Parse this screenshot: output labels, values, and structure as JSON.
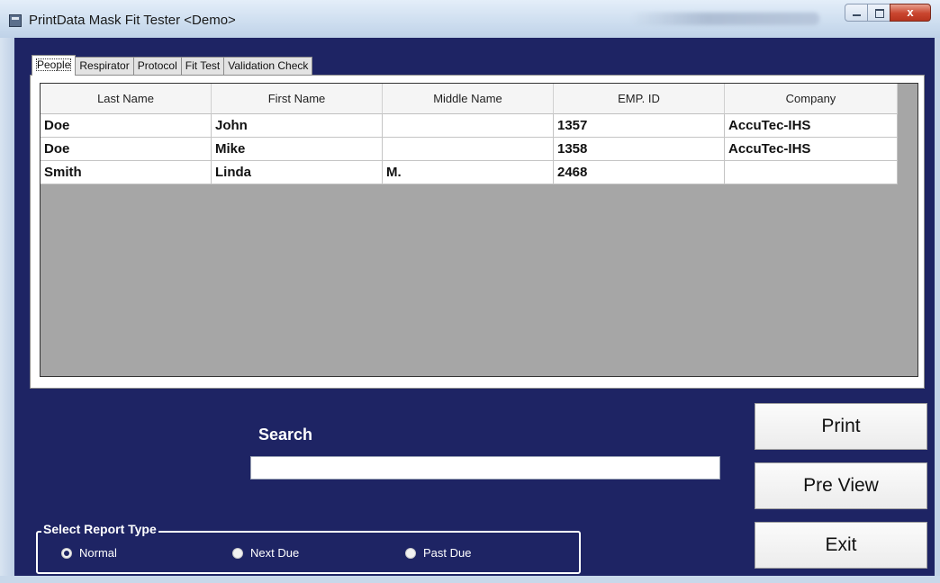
{
  "window": {
    "title": "PrintData Mask Fit Tester <Demo>",
    "close_glyph": "x"
  },
  "tabs": [
    {
      "label": "People",
      "active": true
    },
    {
      "label": "Respirator",
      "active": false
    },
    {
      "label": "Protocol",
      "active": false
    },
    {
      "label": "Fit Test",
      "active": false
    },
    {
      "label": "Validation Check",
      "active": false
    }
  ],
  "table": {
    "columns": [
      "Last Name",
      "First Name",
      "Middle Name",
      "EMP. ID",
      "Company"
    ],
    "rows": [
      [
        "Doe",
        "John",
        "",
        "1357",
        "AccuTec-IHS"
      ],
      [
        "Doe",
        "Mike",
        "",
        "1358",
        "AccuTec-IHS"
      ],
      [
        "Smith",
        "Linda",
        "M.",
        "2468",
        ""
      ]
    ]
  },
  "search": {
    "label": "Search",
    "value": ""
  },
  "buttons": {
    "print": "Print",
    "preview": "Pre View",
    "exit": "Exit"
  },
  "report_type": {
    "title": "Select Report Type",
    "options": [
      {
        "label": "Normal",
        "checked": true
      },
      {
        "label": "Next Due",
        "checked": false
      },
      {
        "label": "Past Due",
        "checked": false
      }
    ]
  },
  "colors": {
    "client_background": "#1e2464",
    "grid_background": "#a6a6a6"
  }
}
